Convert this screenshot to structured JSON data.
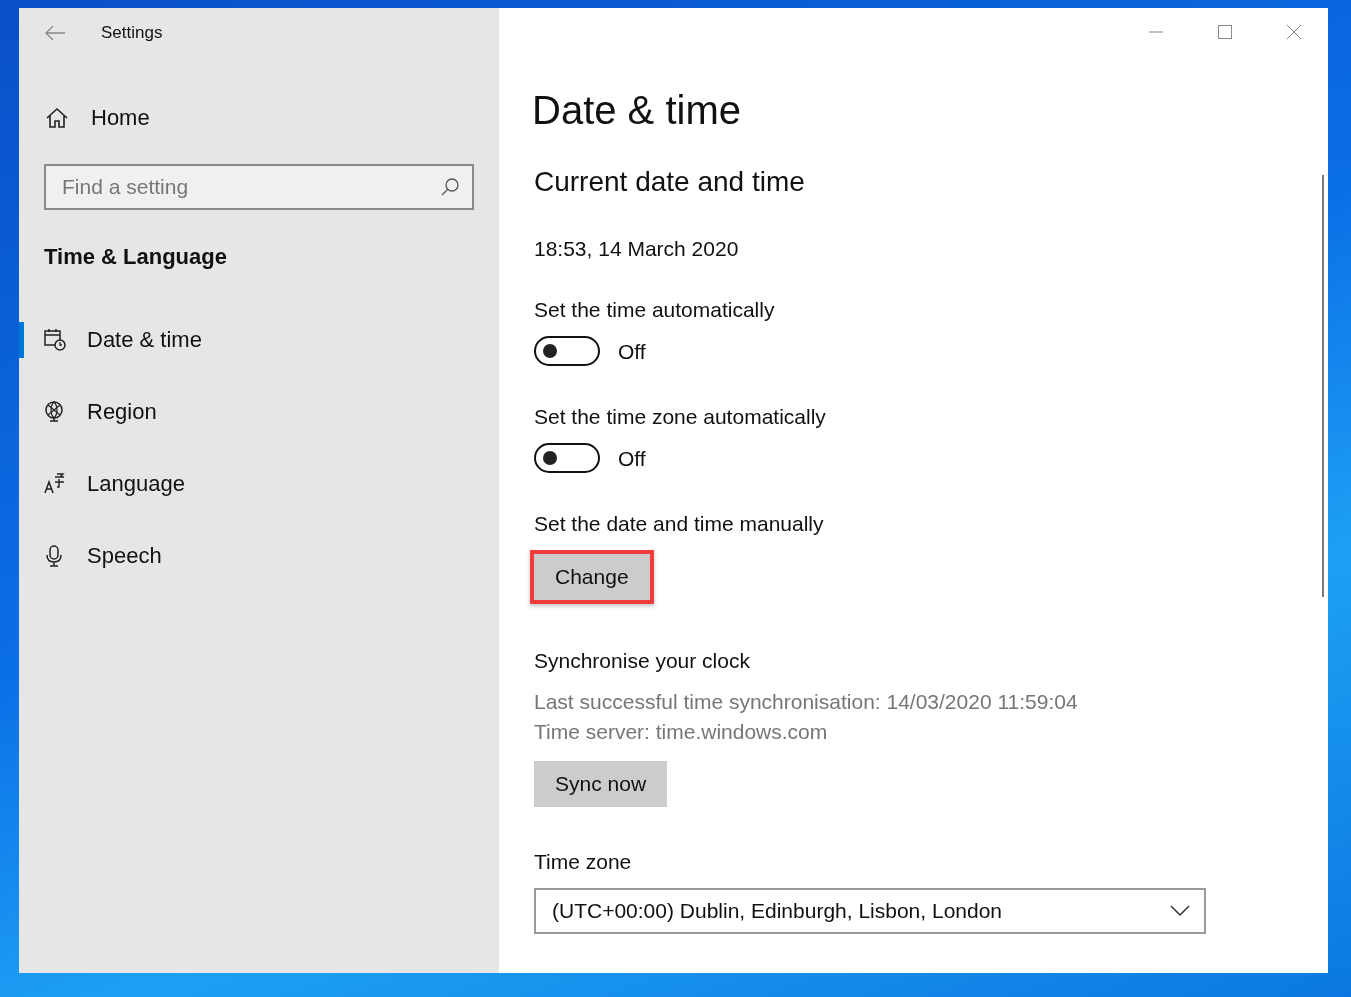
{
  "window": {
    "title": "Settings"
  },
  "sidebar": {
    "home": "Home",
    "search": {
      "placeholder": "Find a setting"
    },
    "section": "Time & Language",
    "items": [
      {
        "label": "Date & time",
        "selected": true
      },
      {
        "label": "Region",
        "selected": false
      },
      {
        "label": "Language",
        "selected": false
      },
      {
        "label": "Speech",
        "selected": false
      }
    ]
  },
  "content": {
    "title": "Date & time",
    "subtitle": "Current date and time",
    "current": "18:53, 14 March 2020",
    "toggles": [
      {
        "label": "Set the time automatically",
        "on": false,
        "state": "Off"
      },
      {
        "label": "Set the time zone automatically",
        "on": false,
        "state": "Off"
      }
    ],
    "manual": {
      "label": "Set the date and time manually",
      "button": "Change",
      "highlighted": true
    },
    "sync": {
      "heading": "Synchronise your clock",
      "lines": [
        "Last successful time synchronisation: 14/03/2020 11:59:04",
        "Time server: time.windows.com"
      ],
      "button": "Sync now"
    },
    "time_zone": {
      "label": "Time zone",
      "value": "(UTC+00:00) Dublin, Edinburgh, Lisbon, London"
    }
  }
}
